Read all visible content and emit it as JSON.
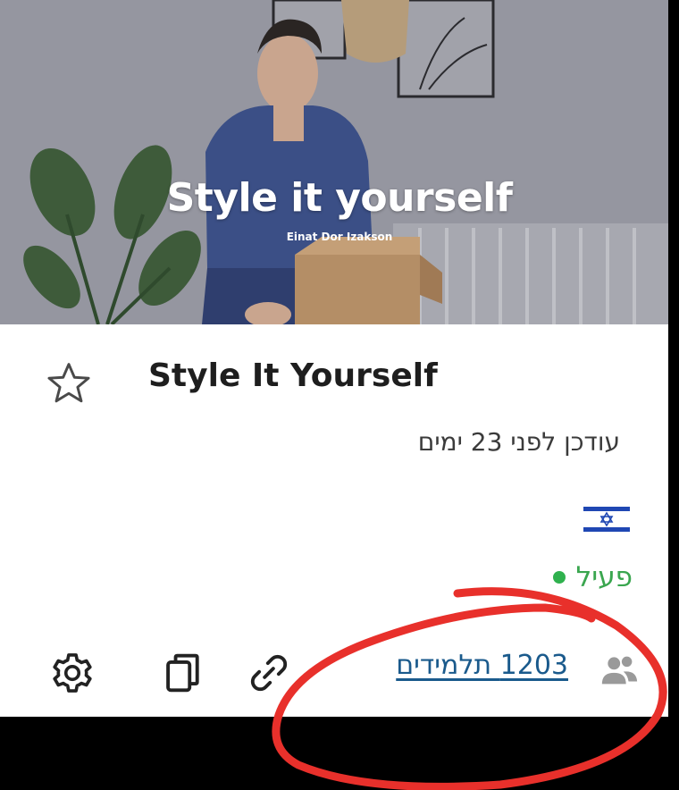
{
  "thumbnail": {
    "title": "Style it yourself",
    "subtitle": "Einat Dor Izakson"
  },
  "course": {
    "title": "Style It Yourself",
    "updated": "עודכן לפני 23 ימים",
    "language_flag": "israel-flag-icon",
    "status": "פעיל",
    "students": "1203 תלמידים"
  },
  "icons": {
    "favorite": "star-outline-icon",
    "students": "users-icon",
    "link": "link-icon",
    "copy": "copy-icon",
    "settings": "gear-icon"
  },
  "colors": {
    "status_green": "#3aa64f",
    "link_blue": "#1a5a8c",
    "annotation_red": "#e8302b"
  }
}
